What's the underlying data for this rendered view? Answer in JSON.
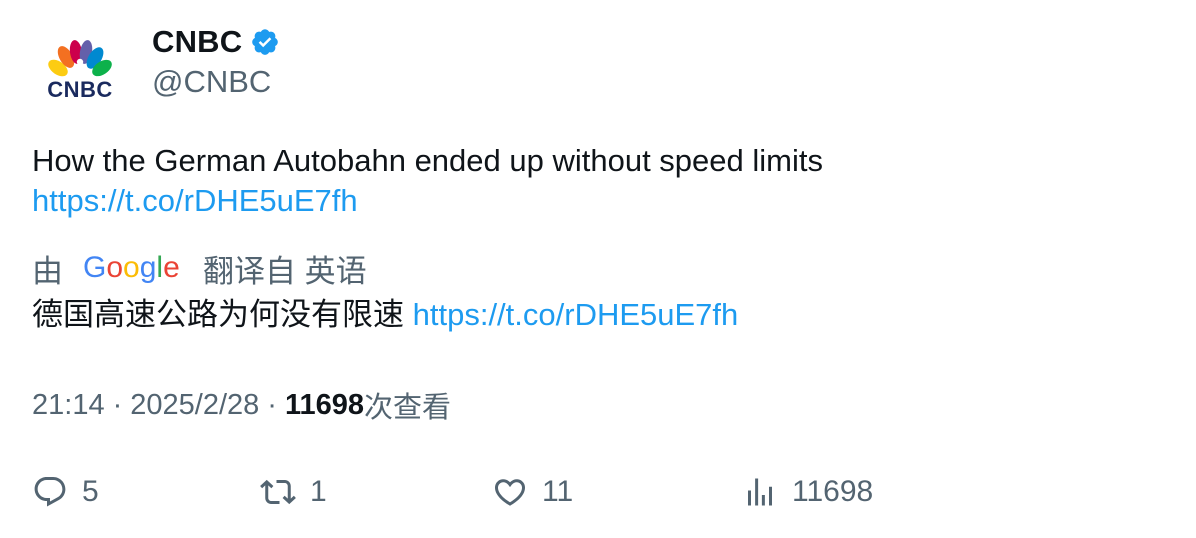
{
  "author": {
    "display_name": "CNBC",
    "handle": "@CNBC",
    "avatar_icon": "cnbc-peacock-logo",
    "logo_text": "CNBC",
    "verified": true,
    "verified_color": "#1d9bf0"
  },
  "tweet": {
    "text": "How the German Autobahn ended up without speed limits",
    "link": "https://t.co/rDHE5uE7fh"
  },
  "translation": {
    "by_label": "由",
    "provider": "Google",
    "from_label": "翻译自 英语",
    "text": "德国高速公路为何没有限速",
    "link": "https://t.co/rDHE5uE7fh"
  },
  "meta": {
    "time": "21:14",
    "separator": "·",
    "date": "2025/2/28",
    "views_count": "11698",
    "views_label": "次查看"
  },
  "actions": {
    "replies": "5",
    "retweets": "1",
    "likes": "11",
    "views": "11698"
  },
  "colors": {
    "text_primary": "#0f1419",
    "text_secondary": "#536471",
    "link": "#1d9bf0"
  }
}
